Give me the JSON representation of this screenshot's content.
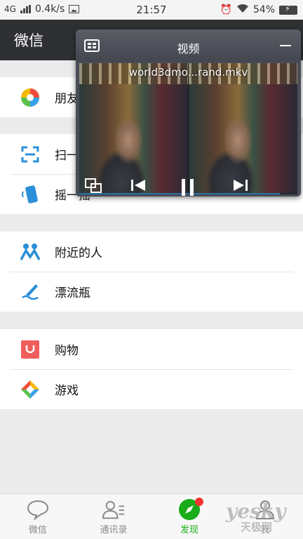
{
  "status_bar": {
    "network": "4G",
    "speed": "0.4k/s",
    "time": "21:57",
    "battery": "54%"
  },
  "header": {
    "title": "微信"
  },
  "groups": [
    {
      "items": [
        {
          "label": "朋友圈",
          "icon": "moments-icon"
        }
      ]
    },
    {
      "items": [
        {
          "label": "扫一扫",
          "icon": "scan-icon"
        },
        {
          "label": "摇一摇",
          "icon": "shake-icon"
        }
      ]
    },
    {
      "items": [
        {
          "label": "附近的人",
          "icon": "nearby-people-icon"
        },
        {
          "label": "漂流瓶",
          "icon": "drift-bottle-icon"
        }
      ]
    },
    {
      "items": [
        {
          "label": "购物",
          "icon": "shopping-icon"
        },
        {
          "label": "游戏",
          "icon": "games-icon"
        }
      ]
    }
  ],
  "tabs": [
    {
      "label": "微信",
      "icon": "chat-bubble-icon",
      "active": false
    },
    {
      "label": "通讯录",
      "icon": "contacts-icon",
      "active": false
    },
    {
      "label": "发现",
      "icon": "compass-icon",
      "active": true
    },
    {
      "label": "我",
      "icon": "person-icon",
      "active": false
    }
  ],
  "video_window": {
    "title": "视频",
    "file_name": "world3dmo...rand.mkv",
    "progress": 0.92
  },
  "watermark": {
    "brand": "yesky",
    "sub": "天极网"
  },
  "colors": {
    "header_bg": "#2e3033",
    "accent_green": "#1aad19",
    "badge_red": "#f43530"
  }
}
